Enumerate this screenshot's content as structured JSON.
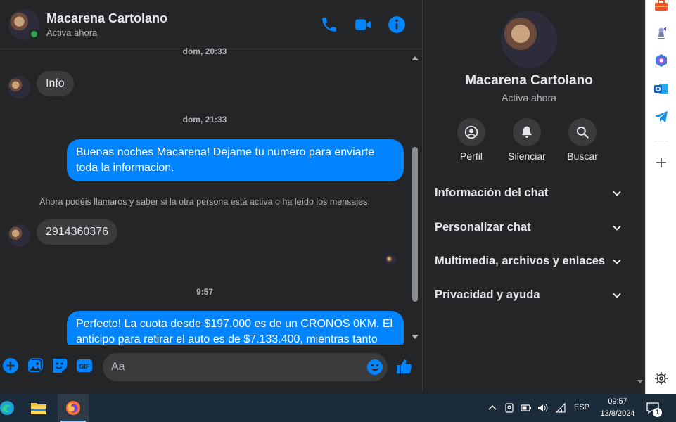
{
  "header": {
    "name": "Macarena Cartolano",
    "status": "Activa ahora",
    "icons": [
      "phone-icon",
      "video-icon",
      "info-icon"
    ],
    "accent": "#0084ff"
  },
  "thread": {
    "timestamps": [
      "dom, 20:33",
      "dom, 21:33",
      "9:57"
    ],
    "messages": [
      {
        "from": "contact",
        "text": "Info"
      },
      {
        "from": "me",
        "text": "Buenas noches Macarena! Dejame tu numero para enviarte toda la informacion."
      },
      {
        "from": "contact",
        "text": "2914360376"
      },
      {
        "from": "me",
        "text": "Perfecto! La cuota desde $197.000 es de un CRONOS 0KM. El anticipo para retirar el auto es de $7.133.400, mientras tanto"
      }
    ],
    "notice": "Ahora podéis llamaros y saber si la otra persona está activa o ha leído los mensajes."
  },
  "composer": {
    "placeholder": "Aa",
    "icons": [
      "plus-icon",
      "image-icon",
      "sticker-icon",
      "gif-icon",
      "emoji-icon",
      "like-icon"
    ]
  },
  "info_panel": {
    "name": "Macarena Cartolano",
    "status": "Activa ahora",
    "actions": [
      {
        "label": "Perfil",
        "icon": "profile-icon"
      },
      {
        "label": "Silenciar",
        "icon": "bell-icon"
      },
      {
        "label": "Buscar",
        "icon": "search-icon"
      }
    ],
    "sections": [
      {
        "label": "Información del chat"
      },
      {
        "label": "Personalizar chat"
      },
      {
        "label": "Multimedia, archivos y enlaces"
      },
      {
        "label": "Privacidad y ayuda"
      }
    ]
  },
  "edge_sidebar": {
    "icons": [
      "toolbox-icon",
      "chess-icon",
      "copilot-icon",
      "outlook-icon",
      "telegram-icon",
      "add-icon",
      "settings-icon"
    ]
  },
  "taskbar": {
    "apps": [
      "edge-icon",
      "file-explorer-icon",
      "firefox-icon"
    ],
    "tray": {
      "language": "ESP",
      "time": "09:57",
      "date": "13/8/2024",
      "notifications": "1"
    }
  },
  "colors": {
    "background": "#242526",
    "bubble_in": "#3a3b3c",
    "bubble_out": "#0084ff",
    "online": "#31a24c",
    "taskbar": "#1c2b3a"
  }
}
